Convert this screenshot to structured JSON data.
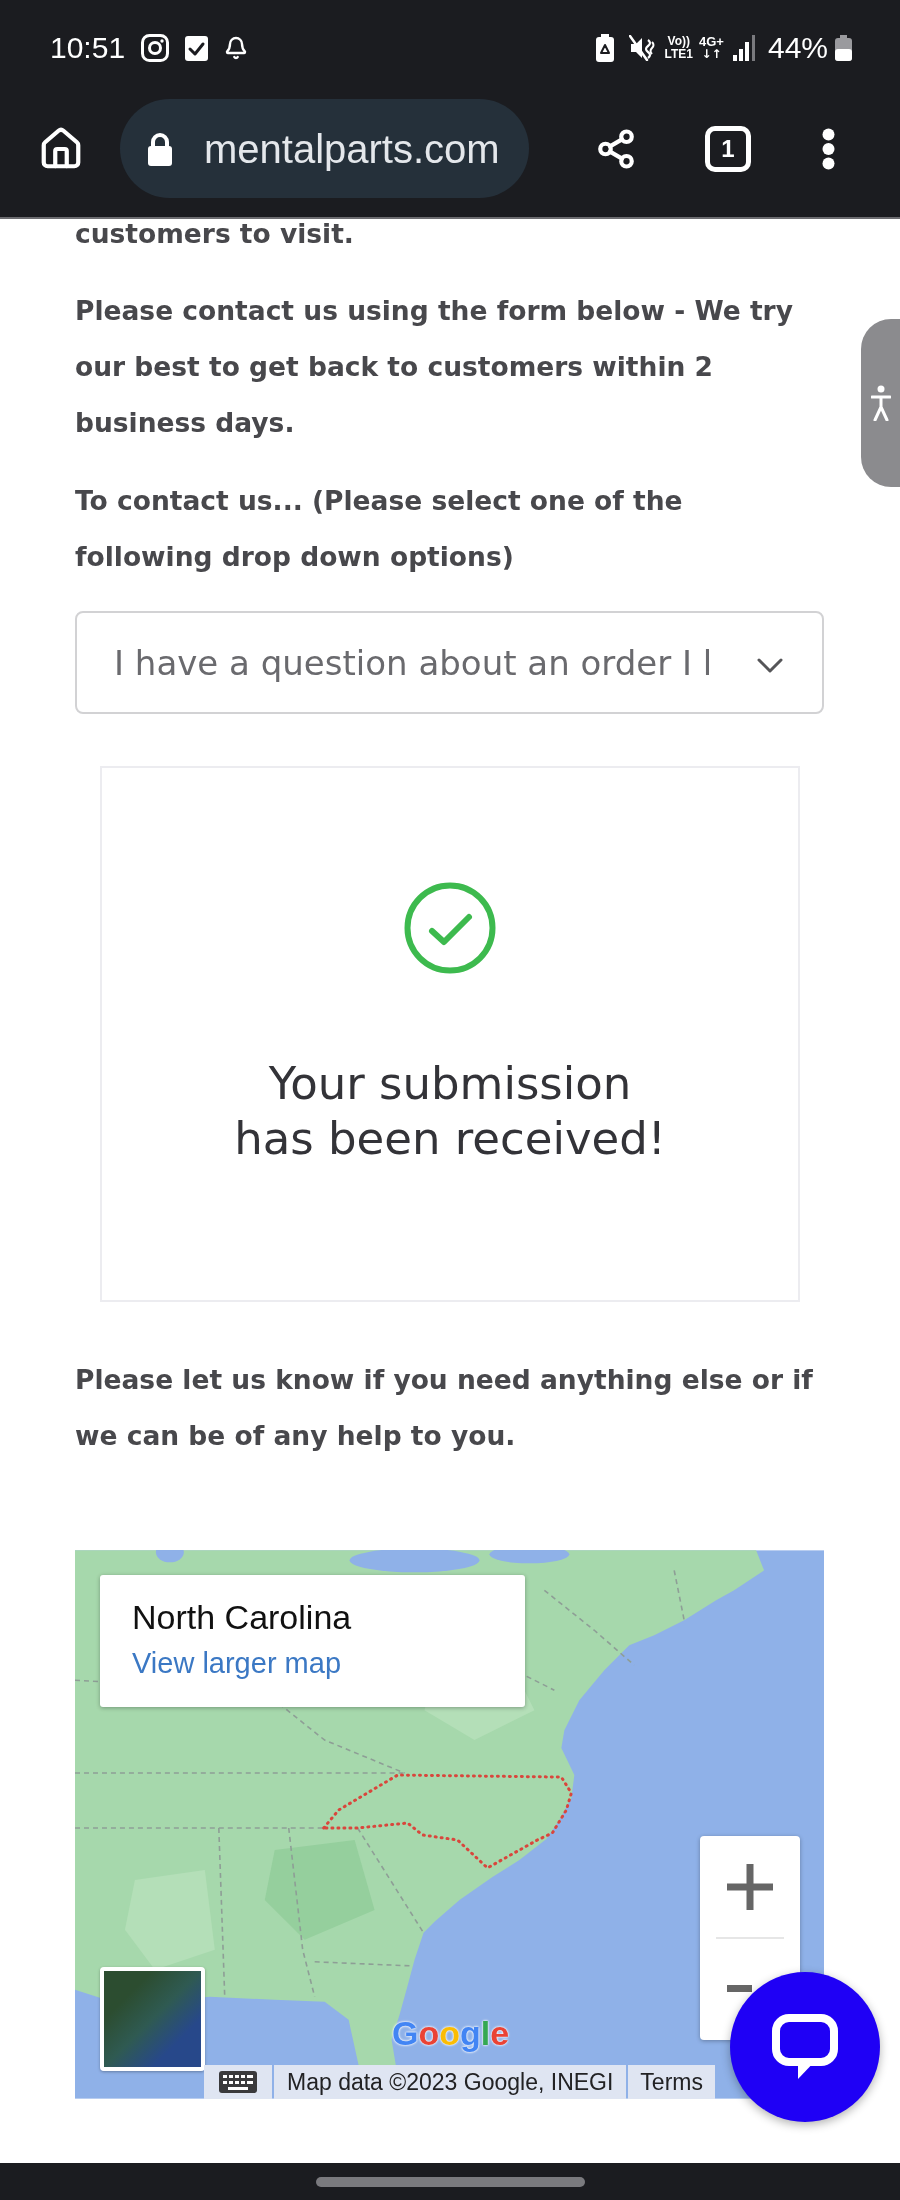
{
  "status_bar": {
    "time": "10:51",
    "volte": [
      "Vo))",
      "LTE1"
    ],
    "network": "4G+",
    "activity": "↓↑",
    "battery": "44%"
  },
  "browser": {
    "url": "mentalparts.com",
    "tab_count": "1"
  },
  "page": {
    "intro_end": "customers to visit.",
    "contact_note": "Please contact us using the form below - We try our best to get back to customers within 2 business days.",
    "select_prompt": "To contact us... (Please select one of the following drop down options)",
    "topic_select": {
      "value": "I have a question about an order I l"
    },
    "confirmation": "Your submission has been received!",
    "closing_note": "Please let us know if you need anything else or if we can be of any help to you."
  },
  "map": {
    "place_title": "North Carolina",
    "link": "View larger map",
    "logo": "Google",
    "attribution": "Map data ©2023 Google, INEGI",
    "terms": "Terms"
  }
}
